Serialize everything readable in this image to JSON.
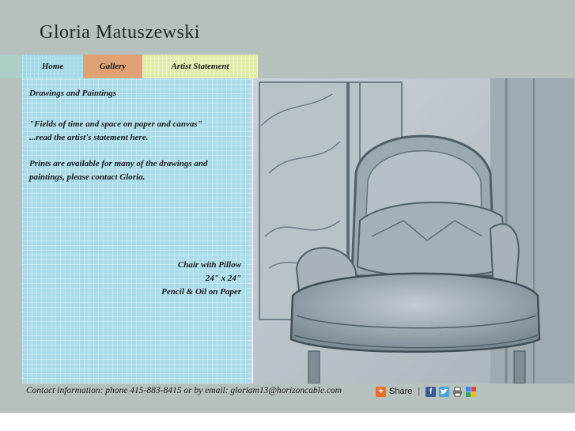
{
  "site": {
    "title": "Gloria Matuszewski"
  },
  "nav": {
    "items": [
      {
        "label": "Home"
      },
      {
        "label": "Gallery"
      },
      {
        "label": "Artist Statement"
      }
    ]
  },
  "panel": {
    "heading": "Drawings and Paintings",
    "quote_line1": "\"Fields of time and space on paper and canvas\"",
    "quote_line2": "...read the artist's statement here.",
    "prints_note": "Prints are available for many of the drawings and paintings, please contact Gloria."
  },
  "artwork": {
    "title": "Chair with Pillow",
    "size": "24\" x 24\"",
    "medium": "Pencil & Oil on Paper"
  },
  "footer": {
    "contact": "Contact information: phone 415-883-8415 or by email: gloriam13@horizoncable.com"
  },
  "share": {
    "label": "Share",
    "separator": "|",
    "icons": [
      "share-plus-icon",
      "facebook-icon",
      "twitter-icon",
      "print-icon",
      "google-icon"
    ]
  },
  "colors": {
    "background": "#b6c0bc",
    "panel": "#a9dbe8",
    "gallery_tab": "#e0a274",
    "artist_tab": "#e0eba6"
  }
}
